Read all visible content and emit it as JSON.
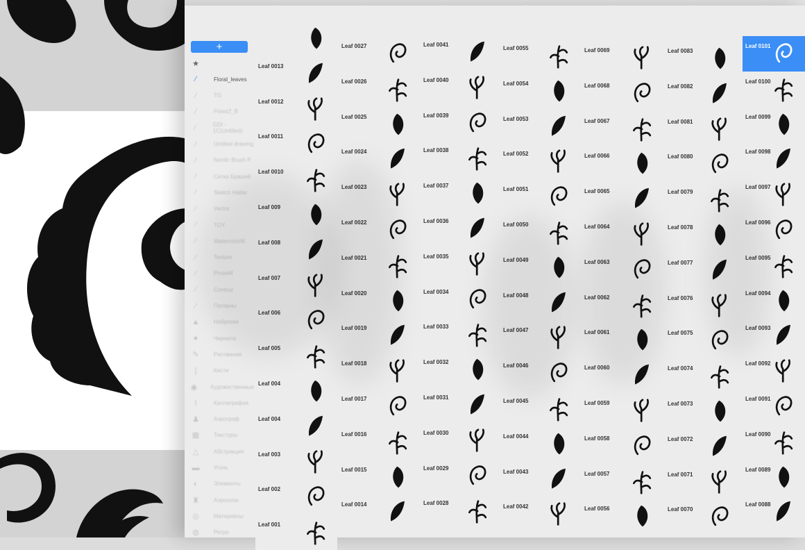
{
  "toolbar": {
    "add_label": "+"
  },
  "sidebar": {
    "items": [
      {
        "label": "",
        "icon": "star-icon"
      },
      {
        "label": "Floral_leaves",
        "icon": "brush-stroke-icon"
      },
      {
        "label": "TG",
        "icon": "brush-stroke-icon"
      },
      {
        "label": "Flowz2_B",
        "icon": "brush-stroke-icon"
      },
      {
        "label": "GDI - 1C(Untitled)",
        "icon": "brush-stroke-icon"
      },
      {
        "label": "Untitled drawing",
        "icon": "brush-stroke-icon"
      },
      {
        "label": "Nordic Brush P.",
        "icon": "brush-stroke-icon"
      },
      {
        "label": "Сетка Брашей",
        "icon": "brush-stroke-icon"
      },
      {
        "label": "Sketch Hatter",
        "icon": "brush-stroke-icon"
      },
      {
        "label": "Vector",
        "icon": "brush-stroke-icon"
      },
      {
        "label": "TOY",
        "icon": "brush-stroke-icon"
      },
      {
        "label": "WatercolorM",
        "icon": "brush-stroke-icon"
      },
      {
        "label": "Texture",
        "icon": "brush-stroke-icon"
      },
      {
        "label": "ProseM",
        "icon": "brush-stroke-icon"
      },
      {
        "label": "Contour",
        "icon": "brush-stroke-icon"
      },
      {
        "label": "Патерны",
        "icon": "brush-stroke-icon"
      },
      {
        "label": "Наброски",
        "icon": "pencil-icon"
      },
      {
        "label": "Чернила",
        "icon": "ink-drop-icon"
      },
      {
        "label": "Рисование",
        "icon": "pen-icon"
      },
      {
        "label": "Кисти",
        "icon": "brush-icon"
      },
      {
        "label": "Художественные",
        "icon": "palette-icon"
      },
      {
        "label": "Каллиграфия",
        "icon": "calligraphy-icon"
      },
      {
        "label": "Аэрограф",
        "icon": "airbrush-icon"
      },
      {
        "label": "Текстуры",
        "icon": "texture-icon"
      },
      {
        "label": "Абстракция",
        "icon": "triangle-icon"
      },
      {
        "label": "Уголь",
        "icon": "charcoal-icon"
      },
      {
        "label": "Элементы",
        "icon": "element-icon"
      },
      {
        "label": "Аэрозоли",
        "icon": "spray-icon"
      },
      {
        "label": "Материалы",
        "icon": "material-icon"
      },
      {
        "label": "Ретро",
        "icon": "retro-icon"
      }
    ]
  },
  "grid": {
    "columns": [
      {
        "items": [
          "",
          "Leaf 0013",
          "Leaf 0012",
          "Leaf 0011",
          "Leaf 0010",
          "Leaf 009",
          "Leaf 008",
          "Leaf 007",
          "Leaf 006",
          "Leaf 005",
          "Leaf 004",
          "Leaf 004",
          "Leaf 003",
          "Leaf 002",
          "Leaf 001"
        ]
      },
      {
        "items": [
          "Leaf 0027",
          "Leaf 0026",
          "Leaf 0025",
          "Leaf 0024",
          "Leaf 0023",
          "Leaf 0022",
          "Leaf 0021",
          "Leaf 0020",
          "Leaf 0019",
          "Leaf 0018",
          "Leaf 0017",
          "Leaf 0016",
          "Leaf 0015",
          "Leaf 0014"
        ]
      },
      {
        "items": [
          "Leaf 0041",
          "Leaf 0040",
          "Leaf 0039",
          "Leaf 0038",
          "Leaf 0037",
          "Leaf 0036",
          "Leaf 0035",
          "Leaf 0034",
          "Leaf 0033",
          "Leaf 0032",
          "Leaf 0031",
          "Leaf 0030",
          "Leaf 0029",
          "Leaf 0028"
        ]
      },
      {
        "items": [
          "Leaf 0055",
          "Leaf 0054",
          "Leaf 0053",
          "Leaf 0052",
          "Leaf 0051",
          "Leaf 0050",
          "Leaf 0049",
          "Leaf 0048",
          "Leaf 0047",
          "Leaf 0046",
          "Leaf 0045",
          "Leaf 0044",
          "Leaf 0043",
          "Leaf 0042"
        ]
      },
      {
        "items": [
          "Leaf 0069",
          "Leaf 0068",
          "Leaf 0067",
          "Leaf 0066",
          "Leaf 0065",
          "Leaf 0064",
          "Leaf 0063",
          "Leaf 0062",
          "Leaf 0061",
          "Leaf 0060",
          "Leaf 0059",
          "Leaf 0058",
          "Leaf 0057",
          "Leaf 0056"
        ]
      },
      {
        "items": [
          "Leaf 0083",
          "Leaf 0082",
          "Leaf 0081",
          "Leaf 0080",
          "Leaf 0079",
          "Leaf 0078",
          "Leaf 0077",
          "Leaf 0076",
          "Leaf 0075",
          "Leaf 0074",
          "Leaf 0073",
          "Leaf 0072",
          "Leaf 0071",
          "Leaf 0070"
        ]
      },
      {
        "items": [
          "Leaf 0101",
          "Leaf 0100",
          "Leaf 0099",
          "Leaf 0098",
          "Leaf 0097",
          "Leaf 0096",
          "Leaf 0095",
          "Leaf 0094",
          "Leaf 0093",
          "Leaf 0092",
          "Leaf 0091",
          "Leaf 0090",
          "Leaf 0089",
          "Leaf 0088"
        ],
        "selected_index": 0
      }
    ]
  },
  "colors": {
    "accent": "#3a8ef6",
    "panel": "#ececec",
    "ink": "#111111"
  }
}
